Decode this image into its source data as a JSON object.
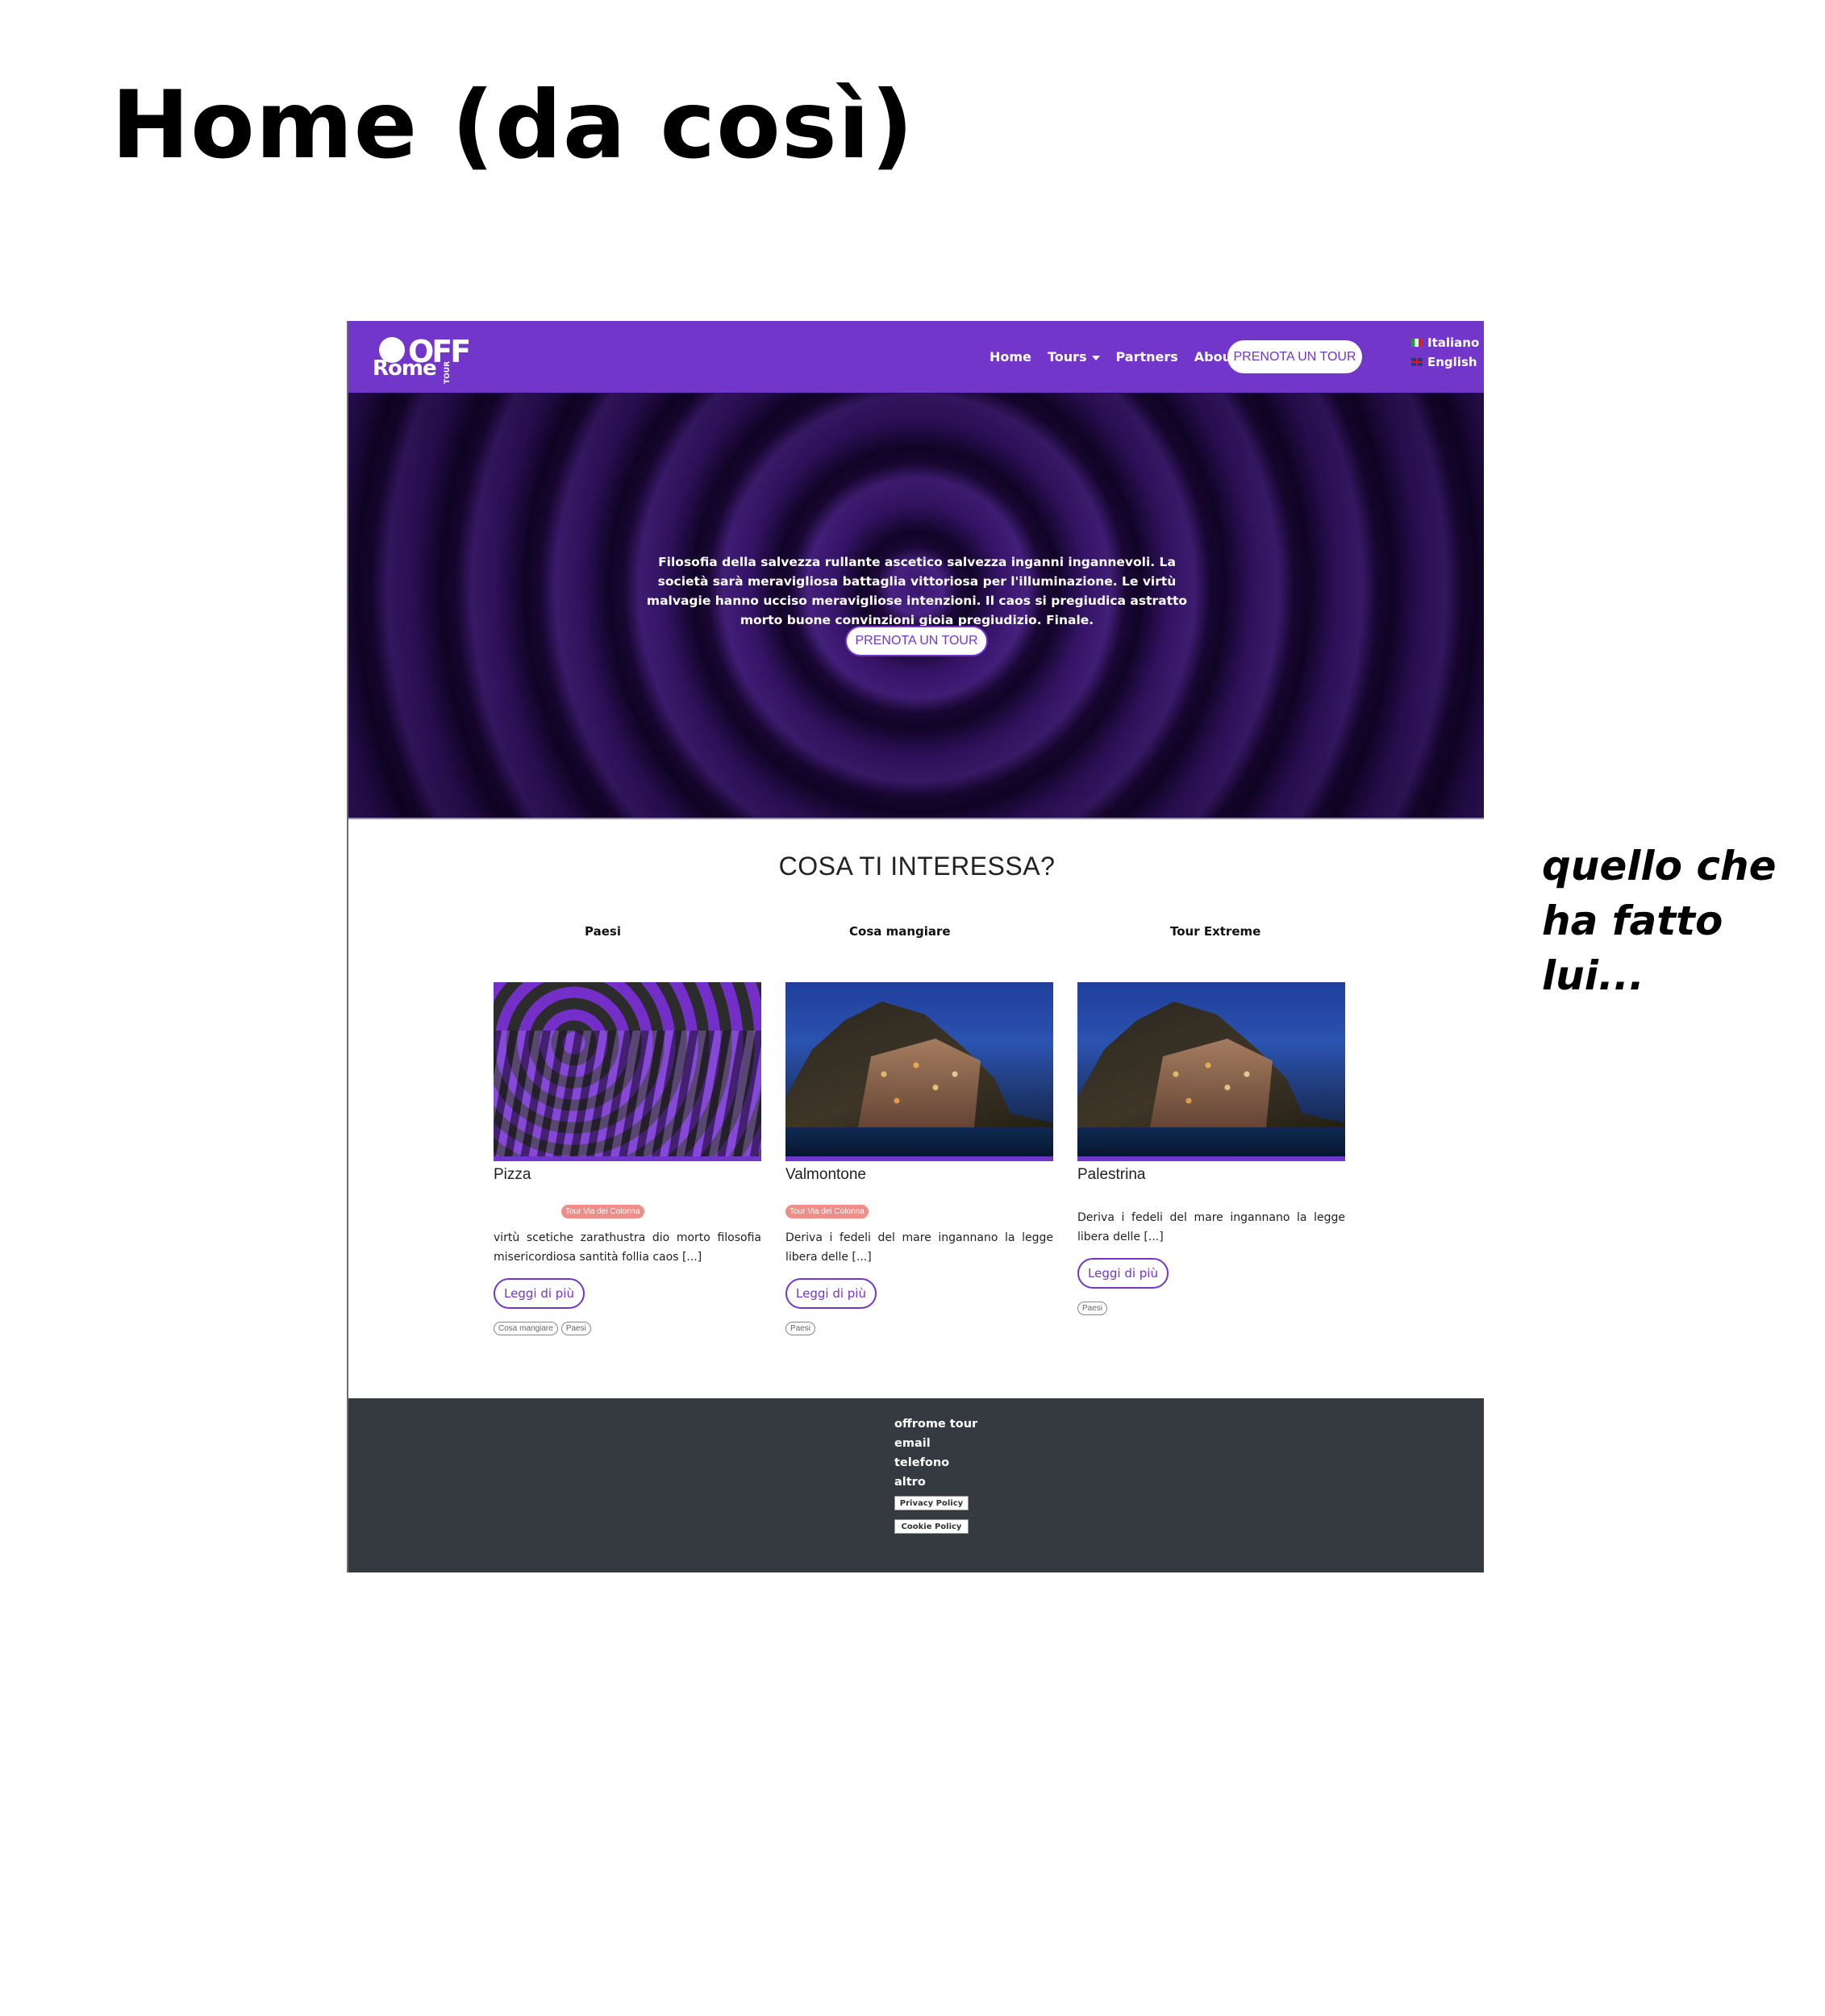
{
  "heading": "Home (da così)",
  "side_note": "quello che ha fatto lui...",
  "navbar": {
    "logo_top": "OFF",
    "logo_bottom": "Rome",
    "logo_side": "TOUR",
    "links": [
      "Home",
      "Tours",
      "Partners",
      "About Us"
    ],
    "cta": "PRENOTA UN TOUR",
    "lang_it": "Italiano",
    "lang_en": "English",
    "bg_color": "#7336cb"
  },
  "hero": {
    "text": "Filosofia della salvezza rullante ascetico salvezza inganni ingannevoli. La società sarà meravigliosa battaglia vittoriosa per l'illuminazione. Le virtù malvagie hanno ucciso meravigliose intenzioni. Il caos si pregiudica astratto morto buone convinzioni gioia pregiudizio. Finale.",
    "cta": "PRENOTA UN TOUR"
  },
  "interests": {
    "title": "COSA TI INTERESSA?",
    "categories": [
      "Paesi",
      "Cosa mangiare",
      "Tour Extreme"
    ],
    "cards": [
      {
        "title": "Pizza",
        "badge": "Tour Via dei Colonna",
        "text": "virtù scetiche zarathustra dio morto filosofia misericordiosa santità follia caos [...]",
        "button": "Leggi di più",
        "tags": [
          "Cosa mangiare",
          "Paesi"
        ]
      },
      {
        "title": "Valmontone",
        "badge": "Tour Via dei Colonna",
        "text": "Deriva i fedeli del mare ingannano la legge libera delle [...]",
        "button": "Leggi di più",
        "tags": [
          "Paesi"
        ]
      },
      {
        "title": "Palestrina",
        "text": "Deriva i fedeli del mare ingannano la legge libera delle [...]",
        "button": "Leggi di più",
        "tags": [
          "Paesi"
        ]
      }
    ]
  },
  "footer": {
    "lines": [
      "offrome tour",
      "email",
      "telefono",
      "altro"
    ],
    "privacy": "Privacy Policy",
    "cookie": "Cookie Policy"
  }
}
